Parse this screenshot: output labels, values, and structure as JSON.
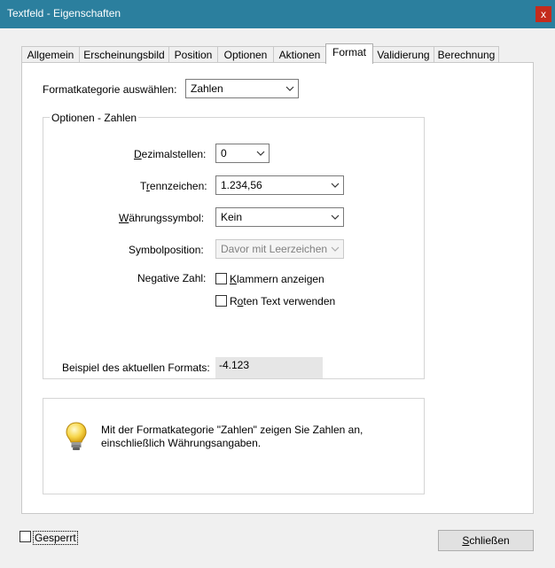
{
  "window": {
    "title": "Textfeld - Eigenschaften",
    "close_glyph": "x"
  },
  "tabs": [
    "Allgemein",
    "Erscheinungsbild",
    "Position",
    "Optionen",
    "Aktionen",
    "Format",
    "Validierung",
    "Berechnung"
  ],
  "active_tab": "Format",
  "format": {
    "category_label": "Formatkategorie auswählen:",
    "category_value": "Zahlen",
    "group_title": "Optionen - Zahlen",
    "decimals_label_pre": "",
    "decimals_label_u": "D",
    "decimals_label_post": "ezimalstellen:",
    "decimals_value": "0",
    "separator_label_pre": "T",
    "separator_label_u": "r",
    "separator_label_post": "ennzeichen:",
    "separator_value": "1.234,56",
    "currency_label_pre": "",
    "currency_label_u": "W",
    "currency_label_post": "ährungssymbol:",
    "currency_value": "Kein",
    "symbolpos_label": "Symbolposition:",
    "symbolpos_value": "Davor mit Leerzeichen",
    "negative_label": "Negative Zahl:",
    "parens_u": "K",
    "parens_rest": "lammern anzeigen",
    "redtext_pre": "R",
    "redtext_u": "o",
    "redtext_rest": "ten Text verwenden",
    "example_label": "Beispiel des aktuellen Formats:",
    "example_value": "-4.123",
    "info_text": "Mit der Formatkategorie \"Zahlen\" zeigen Sie Zahlen an, einschließlich Währungsangaben."
  },
  "footer": {
    "locked_label": "Gesperrt",
    "close_button_u": "S",
    "close_button_rest": "chließen"
  },
  "icons": {
    "info": "lightbulb-icon",
    "dropdown": "chevron-down-icon"
  }
}
